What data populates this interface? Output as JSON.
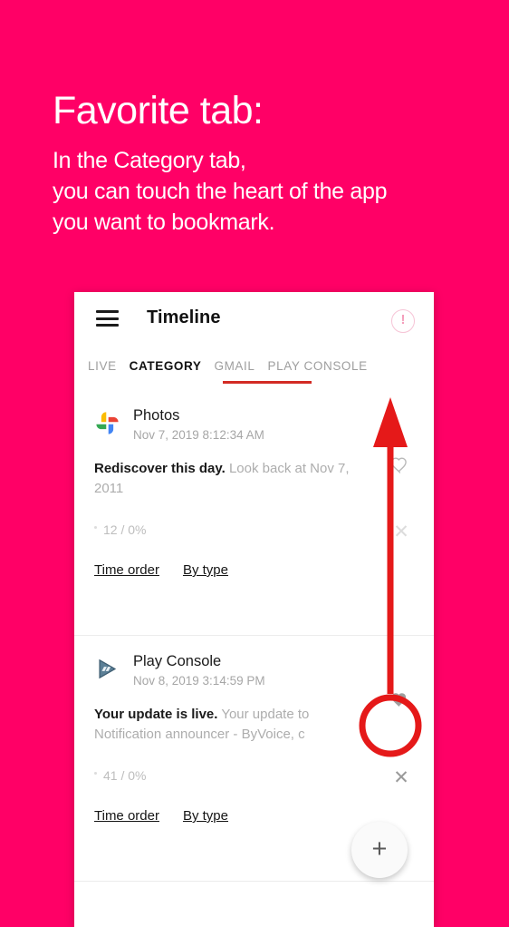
{
  "promo": {
    "title": "Favorite tab:",
    "lines": [
      "In the Category tab,",
      "you can touch the heart of the app",
      "you want to bookmark."
    ],
    "background_color": "#ff0066",
    "text_color": "#ffffff"
  },
  "app": {
    "toolbar": {
      "menu_icon": "hamburger-menu-icon",
      "title": "Timeline",
      "info_icon": "info-exclamation-icon"
    },
    "tabs": {
      "items": [
        {
          "label": "LIVE",
          "active": false
        },
        {
          "label": "CATEGORY",
          "active": true
        },
        {
          "label": "GMAIL",
          "active": false
        },
        {
          "label": "PLAY CONSOLE",
          "active": false
        }
      ],
      "indicator_color": "#d32b24"
    },
    "items": [
      {
        "icon": "google-photos-icon",
        "app_name": "Photos",
        "timestamp": "Nov 7, 2019 8:12:34 AM",
        "body_bold": "Rediscover this day.",
        "body_rest": "Look back at Nov 7, 2011",
        "stats": "12 / 0%",
        "actions": [
          "Time order",
          "By type"
        ],
        "favorite_icon": "heart-outline-icon",
        "favorite_state": "off",
        "close_icon": "close-x-icon"
      },
      {
        "icon": "play-console-icon",
        "app_name": "Play Console",
        "timestamp": "Nov 8, 2019 3:14:59 PM",
        "body_bold": "Your update is live.",
        "body_rest": "Your update to Notification announcer - ByVoice, c",
        "stats": "41 / 0%",
        "actions": [
          "Time order",
          "By type"
        ],
        "favorite_icon": "heart-filled-icon",
        "favorite_state": "on",
        "close_icon": "close-x-icon"
      }
    ],
    "fab": {
      "icon": "plus-icon",
      "label": "+"
    }
  },
  "annotation": {
    "arrow_color": "#e51919",
    "highlight_target": "heart-filled-icon",
    "direction": "up"
  }
}
